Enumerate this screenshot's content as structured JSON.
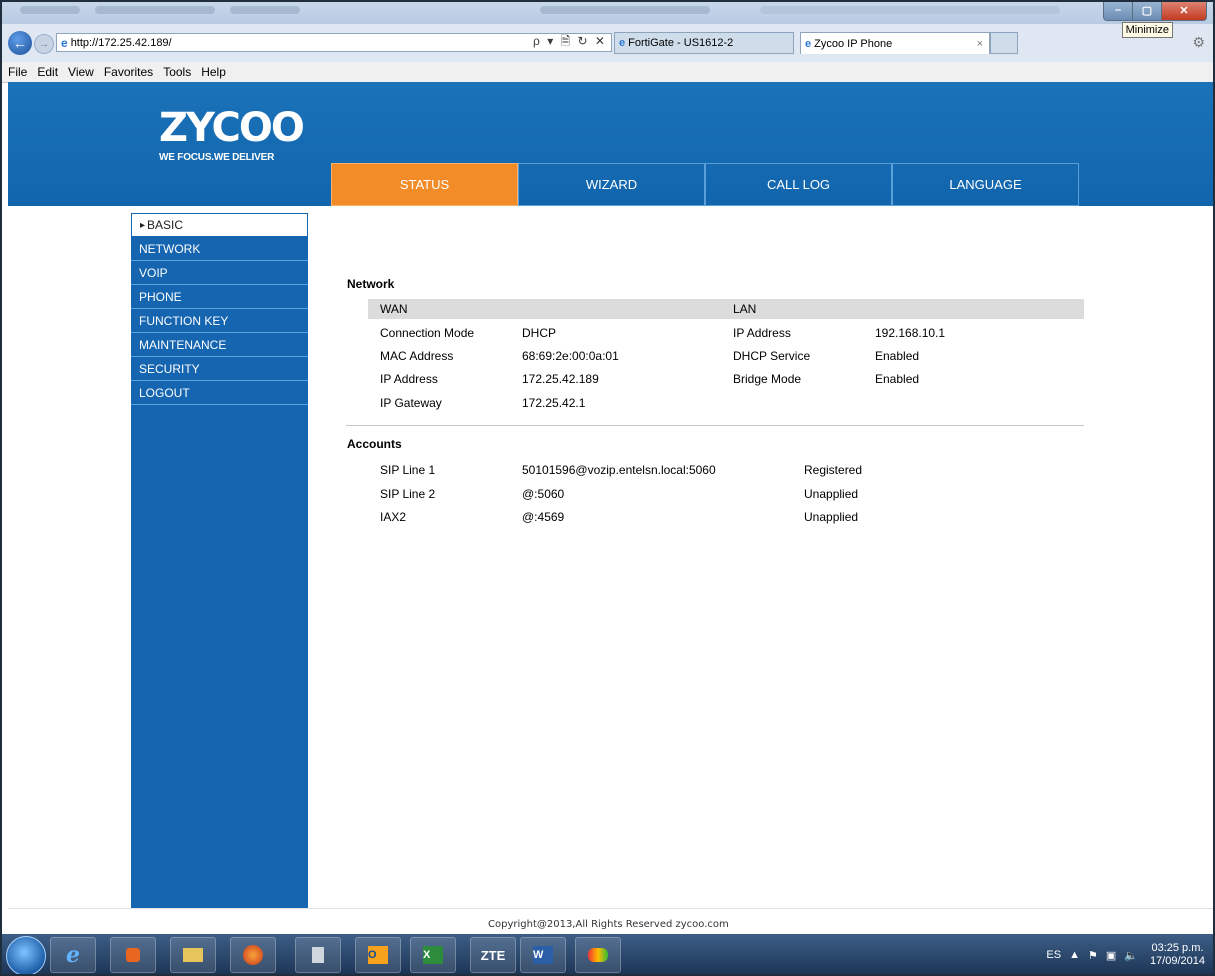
{
  "browser": {
    "url": "http://172.25.42.189/",
    "search_controls": "ρ ▾ 🗎 ↻ ✕",
    "tabs": [
      {
        "title": "FortiGate - US1612-2"
      },
      {
        "title": "Zycoo IP Phone"
      }
    ],
    "tooltip": "Minimize",
    "menu": [
      "File",
      "Edit",
      "View",
      "Favorites",
      "Tools",
      "Help"
    ]
  },
  "brand": {
    "logo": "ZYCOO",
    "tagline": "WE FOCUS.WE DELIVER"
  },
  "topnav": [
    "STATUS",
    "WIZARD",
    "CALL LOG",
    "LANGUAGE"
  ],
  "sidebar": [
    "BASIC",
    "NETWORK",
    "VOIP",
    "PHONE",
    "FUNCTION KEY",
    "MAINTENANCE",
    "SECURITY",
    "LOGOUT"
  ],
  "network": {
    "title": "Network",
    "wan_header": "WAN",
    "lan_header": "LAN",
    "wan": [
      {
        "label": "Connection Mode",
        "value": "DHCP"
      },
      {
        "label": "MAC Address",
        "value": "68:69:2e:00:0a:01"
      },
      {
        "label": "IP Address",
        "value": "172.25.42.189"
      },
      {
        "label": "IP Gateway",
        "value": "172.25.42.1"
      }
    ],
    "lan": [
      {
        "label": "IP Address",
        "value": "192.168.10.1"
      },
      {
        "label": "DHCP Service",
        "value": "Enabled"
      },
      {
        "label": "Bridge Mode",
        "value": "Enabled"
      }
    ]
  },
  "accounts": {
    "title": "Accounts",
    "rows": [
      {
        "name": "SIP Line 1",
        "address": "50101596@vozip.entelsn.local:5060",
        "status": "Registered"
      },
      {
        "name": "SIP Line 2",
        "address": "@:5060",
        "status": "Unapplied"
      },
      {
        "name": "IAX2",
        "address": "@:4569",
        "status": "Unapplied"
      }
    ]
  },
  "footer": "Copyright@2013,All Rights Reserved zycoo.com",
  "taskbar": {
    "apps": [
      "ie",
      "media",
      "explorer",
      "firefox",
      "calculator",
      "outlook",
      "excel",
      "ZTE",
      "word",
      "paint"
    ],
    "lang": "ES",
    "time": "03:25 p.m.",
    "date": "17/09/2014"
  }
}
